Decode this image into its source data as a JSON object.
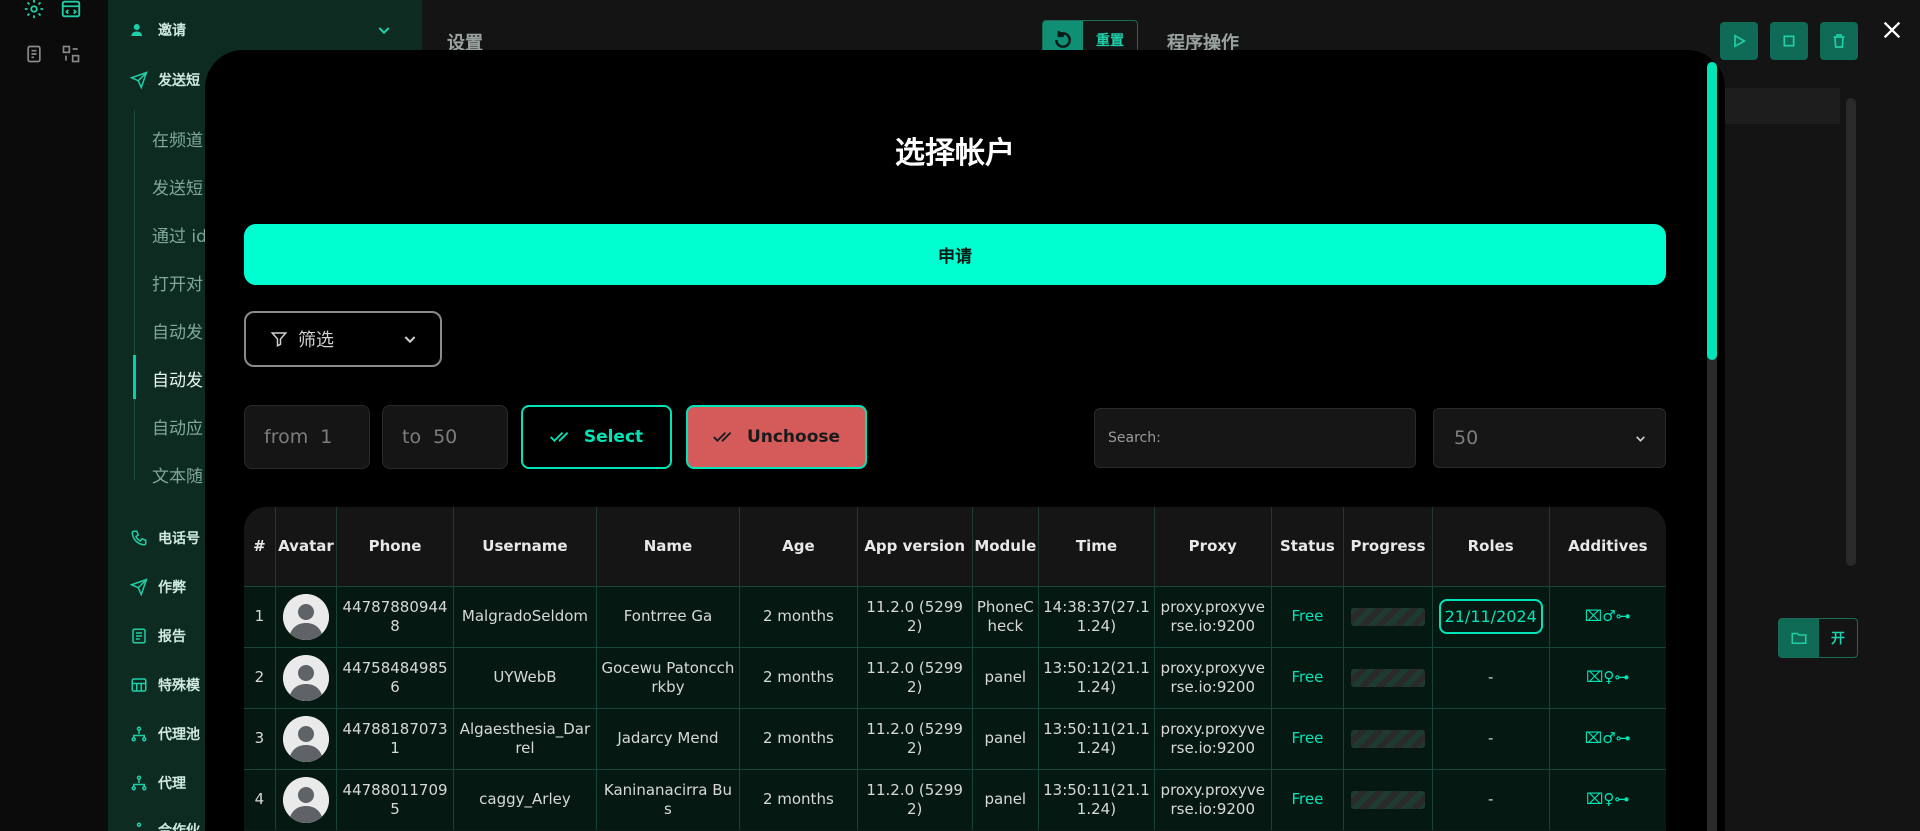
{
  "background": {
    "sidebar_sections": [
      "邀请",
      "发送短",
      "电话号",
      "作弊",
      "报告",
      "特殊模",
      "代理池",
      "代理",
      "合作伙"
    ],
    "sub_items": [
      "在频道",
      "发送短",
      "通过 id",
      "打开对",
      "自动发",
      "自动发",
      "自动应",
      "文本随"
    ],
    "settings_title": "设置",
    "reset_label": "重置",
    "program_ops_title": "程序操作",
    "toggle_label": "开"
  },
  "modal": {
    "title": "选择帐户",
    "apply_label": "申请",
    "filter_label": "筛选",
    "from_label": "from",
    "from_value": "1",
    "to_label": "to",
    "to_value": "50",
    "select_label": "Select",
    "unchoose_label": "Unchoose",
    "search_placeholder": "Search:",
    "per_page": "50"
  },
  "table": {
    "columns": [
      "#",
      "Avatar",
      "Phone",
      "Username",
      "Name",
      "Age",
      "App version",
      "Module",
      "Time",
      "Proxy",
      "Status",
      "Progress",
      "Roles",
      "Additives"
    ],
    "rows": [
      {
        "num": "1",
        "phone": "447878809448",
        "username": "MalgradoSeldom",
        "name": "Fontrree Ga",
        "age": "2 months",
        "app_version": "11.2.0 (52992)",
        "module": "PhoneCheck",
        "time": "14:38:37(27.11.24)",
        "proxy": "proxy.proxyverse.io:9200",
        "status": "Free",
        "roles": "21/11/2024",
        "additives": "⌧♂⊶"
      },
      {
        "num": "2",
        "phone": "447584849856",
        "username": "UYWebB",
        "name": "Gocewu Patoncchrkby",
        "age": "2 months",
        "app_version": "11.2.0 (52992)",
        "module": "panel",
        "time": "13:50:12(21.11.24)",
        "proxy": "proxy.proxyverse.io:9200",
        "status": "Free",
        "roles": "-",
        "additives": "⌧♀⊶"
      },
      {
        "num": "3",
        "phone": "447881870731",
        "username": "Algaesthesia_Darrel",
        "name": "Jadarcy Mend",
        "age": "2 months",
        "app_version": "11.2.0 (52992)",
        "module": "panel",
        "time": "13:50:11(21.11.24)",
        "proxy": "proxy.proxyverse.io:9200",
        "status": "Free",
        "roles": "-",
        "additives": "⌧♂⊶"
      },
      {
        "num": "4",
        "phone": "447880117095",
        "username": "caggy_Arley",
        "name": "Kaninanacirra Bus",
        "age": "2 months",
        "app_version": "11.2.0 (52992)",
        "module": "panel",
        "time": "13:50:11(21.11.24)",
        "proxy": "proxy.proxyverse.io:9200",
        "status": "Free",
        "roles": "-",
        "additives": "⌧♀⊶"
      }
    ]
  },
  "colors": {
    "accent": "#00ffd0",
    "unchoose": "#d55b5b",
    "sidebar": "#0e2b22"
  }
}
